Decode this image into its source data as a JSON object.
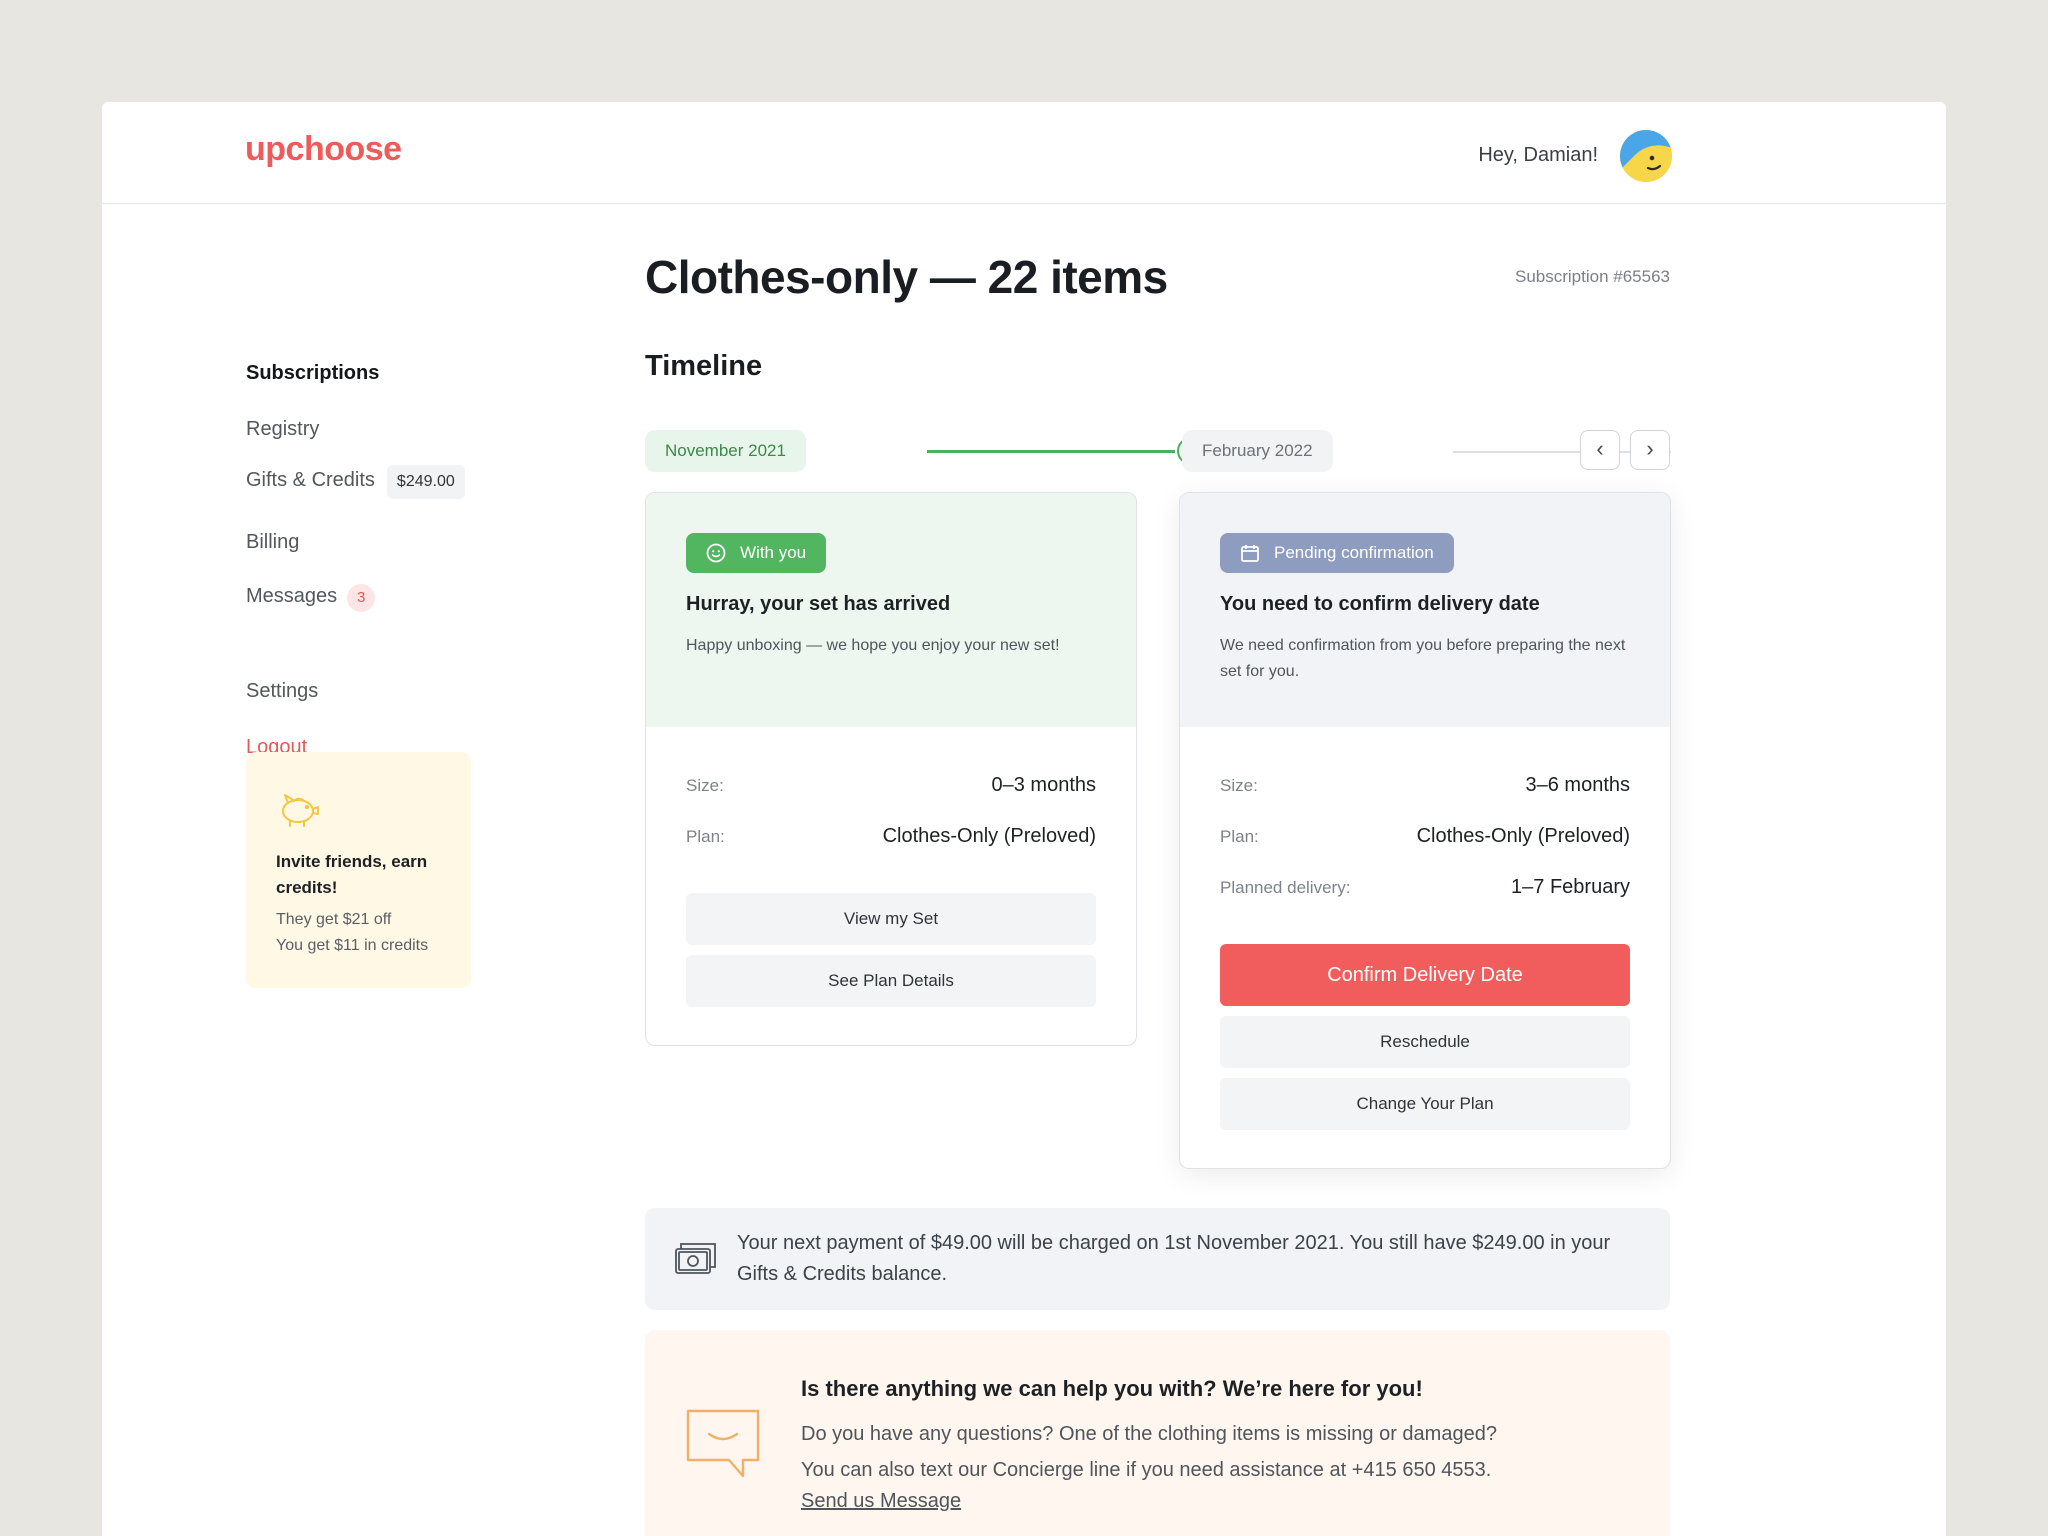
{
  "header": {
    "logo": "upchoose",
    "greeting": "Hey, Damian!"
  },
  "sidebar": {
    "items": [
      {
        "label": "Subscriptions"
      },
      {
        "label": "Registry"
      },
      {
        "label": "Gifts & Credits",
        "badge": "$249.00"
      },
      {
        "label": "Billing"
      },
      {
        "label": "Messages",
        "badge": "3"
      },
      {
        "label": "Settings"
      },
      {
        "label": "Logout"
      }
    ],
    "invite": {
      "title": "Invite friends, earn credits!",
      "line1": "They get $21 off",
      "line2": "You get $11 in credits"
    }
  },
  "main": {
    "title": "Clothes-only — 22 items",
    "subscription_id": "Subscription #65563",
    "section_title": "Timeline",
    "timeline": {
      "current_label": "November 2021",
      "next_label": "February 2022"
    },
    "cards": [
      {
        "status": "With you",
        "heading": "Hurray, your set has arrived",
        "text": "Happy unboxing — we hope you enjoy your new set!",
        "size_label": "Size:",
        "size_value": "0–3 months",
        "plan_label": "Plan:",
        "plan_value": "Clothes-Only (Preloved)",
        "btn1": "View my Set",
        "btn2": "See Plan Details"
      },
      {
        "status": "Pending confirmation",
        "heading": "You need to confirm delivery date",
        "text": "We need confirmation from you before preparing the next set for you.",
        "size_label": "Size:",
        "size_value": "3–6 months",
        "plan_label": "Plan:",
        "plan_value": "Clothes-Only (Preloved)",
        "delivery_label": "Planned delivery:",
        "delivery_value": "1–7 February",
        "primary_btn": "Confirm Delivery Date",
        "btn1": "Reschedule",
        "btn2": "Change Your Plan"
      }
    ],
    "payment_notice": "Your next payment of $49.00 will be charged on 1st November 2021. You still have $249.00 in your Gifts & Credits balance.",
    "help": {
      "heading": "Is there anything we can help you with? We’re here for you!",
      "line1": "Do you have any questions? One of the clothing items is missing or damaged?",
      "line2": "You can also text our Concierge line if you need assistance at +415 650 4553.",
      "link": "Send us Message"
    }
  },
  "colors": {
    "brand": "#ef5a5a",
    "success": "#52b560",
    "pending": "#8e9cc0",
    "primary_button": "#f15c5c"
  }
}
